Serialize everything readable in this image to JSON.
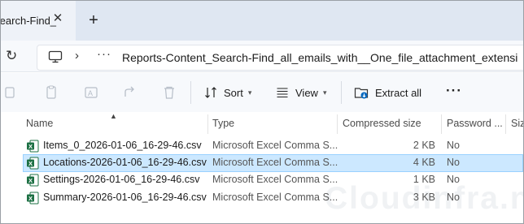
{
  "tab": {
    "title": "Search-Find_"
  },
  "address": {
    "path": "Reports-Content_Search-Find_all_emails_with__One_file_attachment_extensi",
    "overflow": "···"
  },
  "toolbar": {
    "sort_label": "Sort",
    "view_label": "View",
    "extract_label": "Extract all",
    "more_label": "···"
  },
  "columns": [
    "Name",
    "Type",
    "Compressed size",
    "Password ...",
    "Siz"
  ],
  "files": [
    {
      "name": "Items_0_2026-01-06_16-29-46.csv",
      "type": "Microsoft Excel Comma S...",
      "size": "2 KB",
      "password": "No",
      "selected": false
    },
    {
      "name": "Locations-2026-01-06_16-29-46.csv",
      "type": "Microsoft Excel Comma S...",
      "size": "4 KB",
      "password": "No",
      "selected": true
    },
    {
      "name": "Settings-2026-01-06_16-29-46.csv",
      "type": "Microsoft Excel Comma S...",
      "size": "1 KB",
      "password": "No",
      "selected": false
    },
    {
      "name": "Summary-2026-01-06_16-29-46.csv",
      "type": "Microsoft Excel Comma S...",
      "size": "3 KB",
      "password": "No",
      "selected": false
    }
  ],
  "watermark": "Cloudinfra.net",
  "colors": {
    "selection": "#cce8ff",
    "excel": "#1d7044",
    "accent": "#0067c0"
  }
}
